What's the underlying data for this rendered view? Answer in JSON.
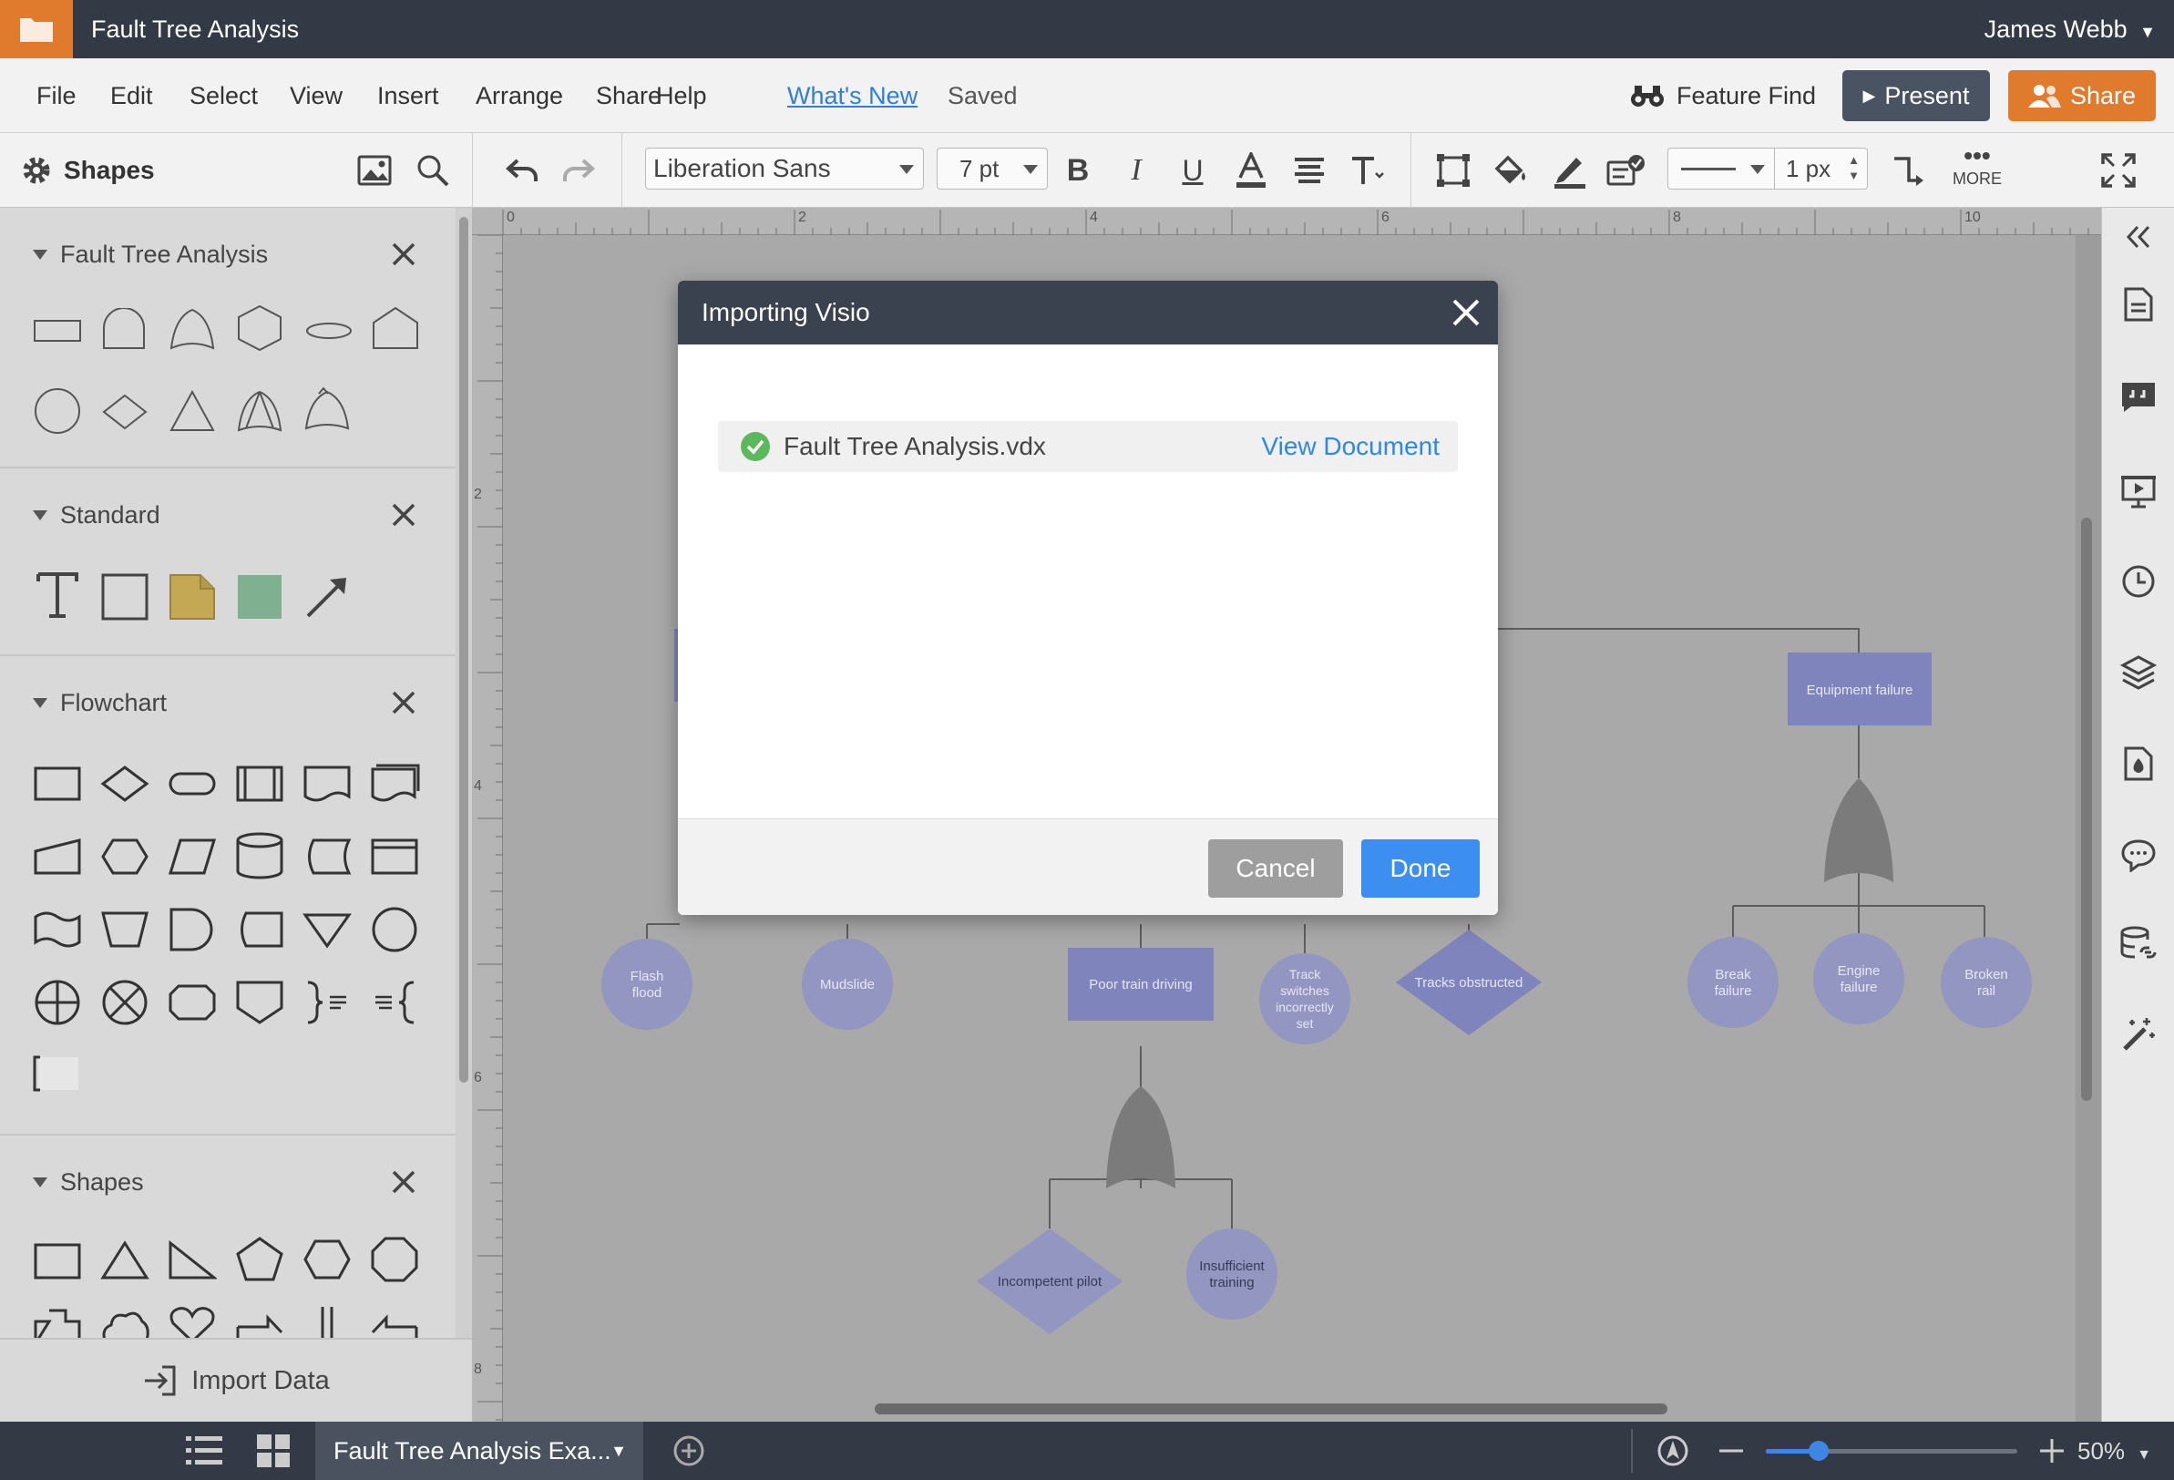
{
  "window": {
    "title": "Fault Tree Analysis",
    "user": "James Webb"
  },
  "menu": {
    "items": [
      "File",
      "Edit",
      "Select",
      "View",
      "Insert",
      "Arrange",
      "Share",
      "Help"
    ],
    "whats_new": "What's New",
    "saved_status": "Saved",
    "feature_find": "Feature Find",
    "present": "Present",
    "share": "Share"
  },
  "toolbar": {
    "shapes_label": "Shapes",
    "font": "Liberation Sans",
    "font_size": "7 pt",
    "line_width": "1 px",
    "more": "MORE"
  },
  "left_panel": {
    "sections": [
      {
        "title": "Fault Tree Analysis"
      },
      {
        "title": "Standard"
      },
      {
        "title": "Flowchart"
      },
      {
        "title": "Shapes"
      }
    ],
    "import_data": "Import Data"
  },
  "rulers": {
    "top": [
      "0",
      "2",
      "4",
      "6",
      "8",
      "10"
    ],
    "left": [
      "2",
      "4",
      "6",
      "8"
    ]
  },
  "diagram": {
    "nodes": {
      "equipment_failure": "Equipment failure",
      "flash_flood": [
        "Flash",
        "flood"
      ],
      "mudslide": "Mudslide",
      "poor_train_driving": "Poor train driving",
      "track_switches": [
        "Track",
        "switches",
        "incorrectly",
        "set"
      ],
      "tracks_obstructed": "Tracks obstructed",
      "break_failure": [
        "Break",
        "failure"
      ],
      "engine_failure": [
        "Engine",
        "failure"
      ],
      "broken_rail": [
        "Broken",
        "rail"
      ],
      "incompetent_pilot": "Incompetent pilot",
      "insufficient_training": [
        "Insufficient",
        "training"
      ]
    },
    "colors": {
      "node": "#7f84bd",
      "node_light": "#9396c0",
      "gate": "#7b7b7b",
      "line": "#5e5e5e"
    }
  },
  "dialog": {
    "title": "Importing Visio",
    "file_name": "Fault Tree Analysis.vdx",
    "view_document": "View Document",
    "cancel": "Cancel",
    "done": "Done"
  },
  "bottom": {
    "page_tab": "Fault Tree Analysis Exa...",
    "zoom": "50%",
    "zoom_fraction": 0.21
  },
  "colors": {
    "accent": "#e07b2e",
    "primary_button": "#3c8ef0",
    "link": "#2f87e6",
    "dark_bar": "#333a45"
  }
}
